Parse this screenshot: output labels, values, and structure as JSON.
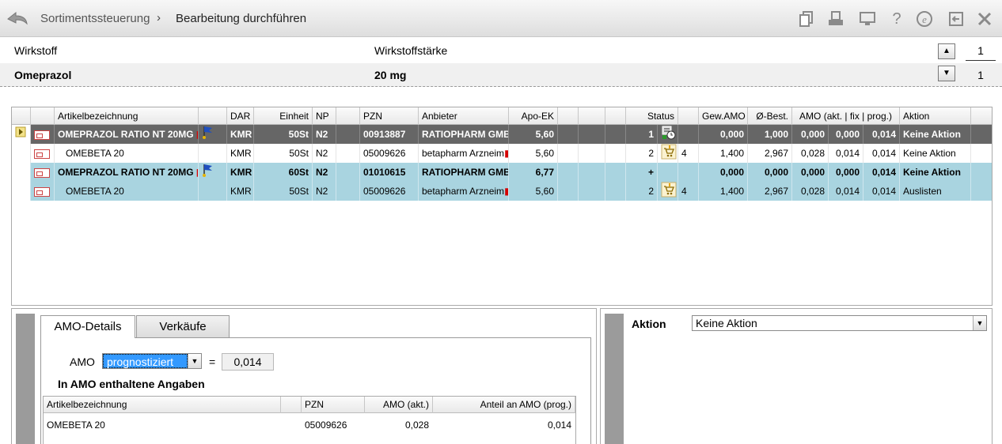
{
  "titlebar": {
    "breadcrumb_root": "Sortimentssteuerung",
    "breadcrumb_separator": "›",
    "breadcrumb_current": "Bearbeitung durchführen"
  },
  "header": {
    "wirkstoff_label": "Wirkstoff",
    "wirkstoffstaerke_label": "Wirkstoffstärke",
    "wirkstoff_value": "Omeprazol",
    "staerke_value": "20 mg",
    "page_top": "1",
    "page_bottom": "1"
  },
  "grid": {
    "columns": [
      "Artikelbezeichnung",
      "DAR",
      "Einheit",
      "NP",
      "PZN",
      "Anbieter",
      "Apo-EK",
      "Status",
      "Gew.AMO",
      "Ø-Best.",
      "AMO (akt. | fix | prog.)",
      "Aktion"
    ],
    "rows": [
      {
        "name": "OMEPRAZOL RATIO NT 20MG",
        "dar": "KMR",
        "einheit": "50St",
        "np": "N2",
        "pzn": "00913887",
        "anbieter": "RATIOPHARM GMB",
        "apoek": "5,60",
        "status": "1",
        "statuscount": "",
        "gewamo": "0,000",
        "obest": "1,000",
        "amo_akt": "0,000",
        "amo_fix": "0,000",
        "amo_prog": "0,014",
        "aktion": "Keine Aktion"
      },
      {
        "name": "OMEBETA 20",
        "dar": "KMR",
        "einheit": "50St",
        "np": "N2",
        "pzn": "05009626",
        "anbieter": "betapharm Arzneim",
        "apoek": "5,60",
        "status": "2",
        "statuscount": "4",
        "gewamo": "1,400",
        "obest": "2,967",
        "amo_akt": "0,028",
        "amo_fix": "0,014",
        "amo_prog": "0,014",
        "aktion": "Keine Aktion"
      },
      {
        "name": "OMEPRAZOL RATIO NT 20MG",
        "dar": "KMR",
        "einheit": "60St",
        "np": "N2",
        "pzn": "01010615",
        "anbieter": "RATIOPHARM GMB",
        "apoek": "6,77",
        "status": "+",
        "statuscount": "",
        "gewamo": "0,000",
        "obest": "0,000",
        "amo_akt": "0,000",
        "amo_fix": "0,000",
        "amo_prog": "0,014",
        "aktion": "Keine Aktion"
      },
      {
        "name": "OMEBETA 20",
        "dar": "KMR",
        "einheit": "50St",
        "np": "N2",
        "pzn": "05009626",
        "anbieter": "betapharm Arzneim",
        "apoek": "5,60",
        "status": "2",
        "statuscount": "4",
        "gewamo": "1,400",
        "obest": "2,967",
        "amo_akt": "0,028",
        "amo_fix": "0,014",
        "amo_prog": "0,014",
        "aktion": "Auslisten"
      }
    ]
  },
  "details": {
    "tab_amo": "AMO-Details",
    "tab_verkaeufe": "Verkäufe",
    "amo_label": "AMO",
    "amo_mode": "prognostiziert",
    "equals": "=",
    "amo_value": "0,014",
    "section_title": "In AMO enthaltene Angaben",
    "sub_columns": [
      "Artikelbezeichnung",
      "PZN",
      "AMO (akt.)",
      "Anteil an AMO (prog.)"
    ],
    "sub_rows": [
      {
        "name": "OMEBETA 20",
        "pzn": "05009626",
        "amo_akt": "0,028",
        "anteil": "0,014"
      }
    ]
  },
  "action_panel": {
    "label": "Aktion",
    "value": "Keine Aktion"
  },
  "colors": {
    "selected_row": "#666666",
    "highlight_row": "#a9d4e0",
    "combo_selection": "#3399ff"
  }
}
